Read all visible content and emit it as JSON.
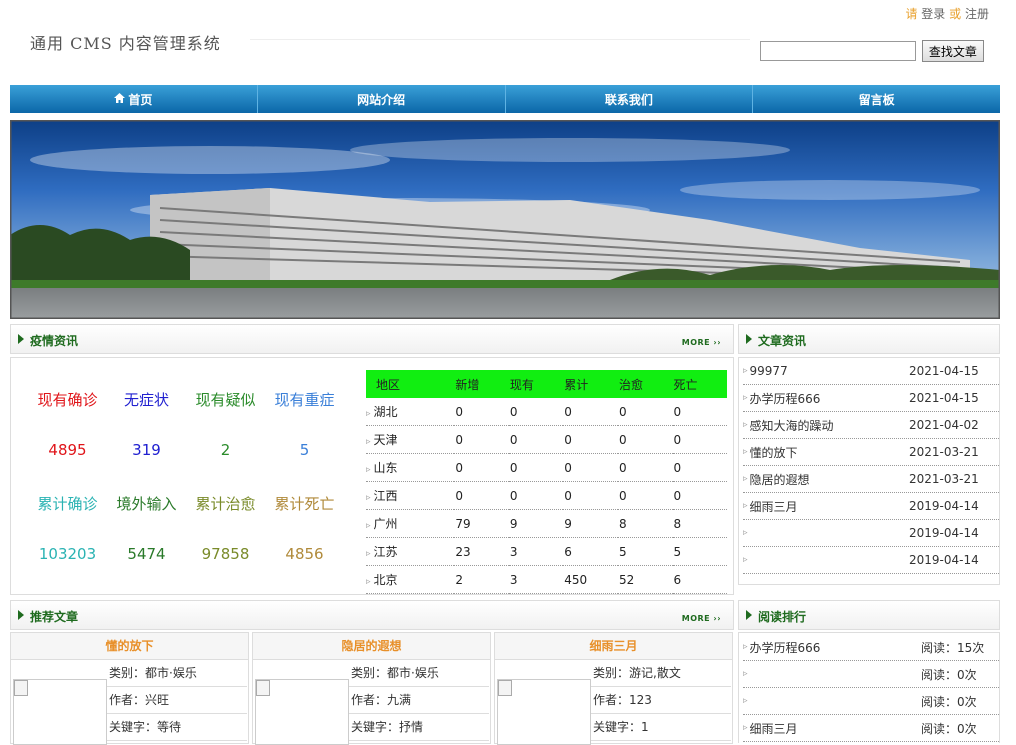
{
  "header": {
    "site_title": "通用 CMS 内容管理系统",
    "please": "请",
    "login": "登录",
    "or": "或",
    "register": "注册",
    "search_placeholder": "",
    "search_button": "查找文章"
  },
  "nav": [
    {
      "label": "首页",
      "icon": "home-icon"
    },
    {
      "label": "网站介绍"
    },
    {
      "label": "联系我们"
    },
    {
      "label": "留言板"
    }
  ],
  "epidemic": {
    "title": "疫情资讯",
    "more": "MORE ››",
    "stats": [
      {
        "label": "现有确诊",
        "value": "4895",
        "color": "#e0151a"
      },
      {
        "label": "无症状",
        "value": "319",
        "color": "#2020d0"
      },
      {
        "label": "现有疑似",
        "value": "2",
        "color": "#2a8b2a"
      },
      {
        "label": "现有重症",
        "value": "5",
        "color": "#3a7fd8"
      },
      {
        "label": "累计确诊",
        "value": "103203",
        "color": "#2ab3b3"
      },
      {
        "label": "境外输入",
        "value": "5474",
        "color": "#2a7a2a"
      },
      {
        "label": "累计治愈",
        "value": "97858",
        "color": "#7a8b2a"
      },
      {
        "label": "累计死亡",
        "value": "4856",
        "color": "#b08a3a"
      }
    ],
    "table": {
      "headers": [
        "地区",
        "新增",
        "现有",
        "累计",
        "治愈",
        "死亡"
      ],
      "rows": [
        [
          "湖北",
          "0",
          "0",
          "0",
          "0",
          "0"
        ],
        [
          "天津",
          "0",
          "0",
          "0",
          "0",
          "0"
        ],
        [
          "山东",
          "0",
          "0",
          "0",
          "0",
          "0"
        ],
        [
          "江西",
          "0",
          "0",
          "0",
          "0",
          "0"
        ],
        [
          "广州",
          "79",
          "9",
          "9",
          "8",
          "8"
        ],
        [
          "江苏",
          "23",
          "3",
          "6",
          "5",
          "5"
        ],
        [
          "北京",
          "2",
          "3",
          "450",
          "52",
          "6"
        ]
      ]
    }
  },
  "articles": {
    "title": "文章资讯",
    "items": [
      {
        "title": "99977",
        "date": "2021-04-15"
      },
      {
        "title": "办学历程666",
        "date": "2021-04-15"
      },
      {
        "title": "感知大海的躁动",
        "date": "2021-04-02"
      },
      {
        "title": "懂的放下",
        "date": "2021-03-21"
      },
      {
        "title": "隐居的遐想",
        "date": "2021-03-21"
      },
      {
        "title": "细雨三月",
        "date": "2019-04-14"
      },
      {
        "title": "",
        "date": "2019-04-14"
      },
      {
        "title": "",
        "date": "2019-04-14"
      }
    ]
  },
  "recommended": {
    "title": "推荐文章",
    "more": "MORE ››",
    "cards": [
      {
        "title": "懂的放下",
        "category": "类别：都市·娱乐",
        "author": "作者：兴旺",
        "keywords": "关键字：等待"
      },
      {
        "title": "隐居的遐想",
        "category": "类别：都市·娱乐",
        "author": "作者：九满",
        "keywords": "关键字：抒情"
      },
      {
        "title": "细雨三月",
        "category": "类别：游记,散文",
        "author": "作者：123",
        "keywords": "关键字：1"
      }
    ]
  },
  "ranking": {
    "title": "阅读排行",
    "items": [
      {
        "title": "办学历程666",
        "reads": "阅读：15次"
      },
      {
        "title": "",
        "reads": "阅读：0次"
      },
      {
        "title": "",
        "reads": "阅读：0次"
      },
      {
        "title": "细雨三月",
        "reads": "阅读：0次"
      }
    ]
  }
}
